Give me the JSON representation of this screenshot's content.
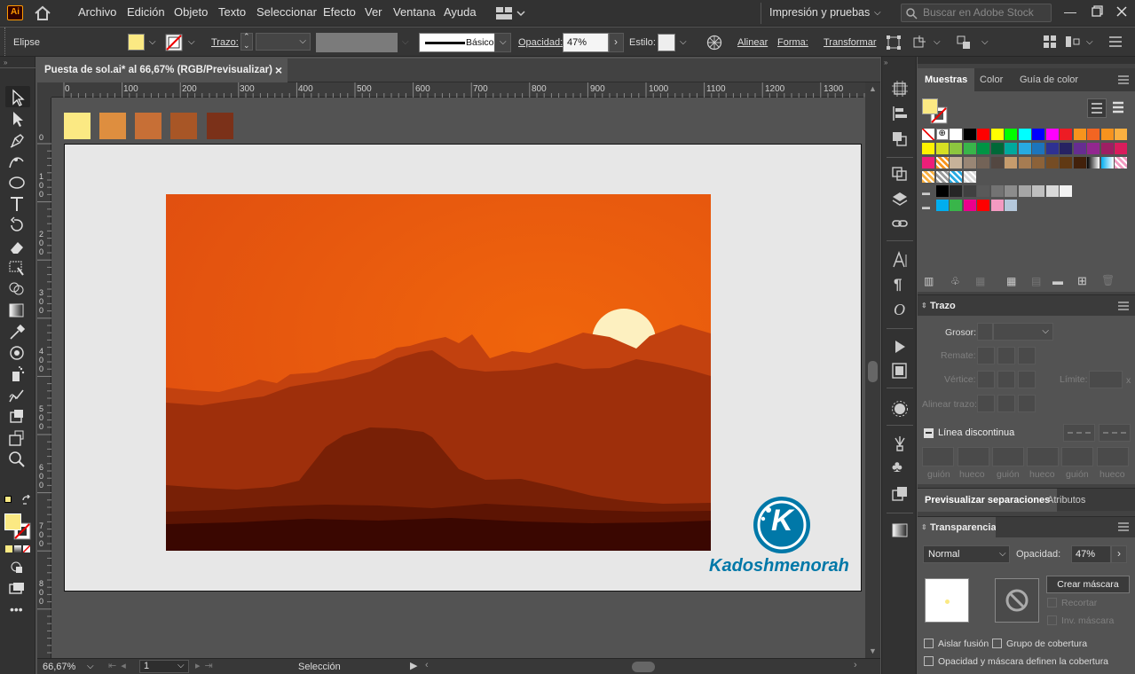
{
  "menubar": {
    "app_logo": "Ai",
    "items": [
      "Archivo",
      "Edición",
      "Objeto",
      "Texto",
      "Seleccionar",
      "Efecto",
      "Ver",
      "Ventana",
      "Ayuda"
    ],
    "workspace": "Impresión y pruebas",
    "search_placeholder": "Buscar en Adobe Stock"
  },
  "control_bar": {
    "object_type": "Elipse",
    "stroke_label": "Trazo:",
    "brush_label": "Básico",
    "opacity_label": "Opacidad:",
    "opacity_value": "47%",
    "style_label": "Estilo:",
    "align_label": "Alinear",
    "shape_label": "Forma:",
    "transform_label": "Transformar"
  },
  "document_tab": {
    "title": "Puesta de sol.ai* al 66,67% (RGB/Previsualizar)",
    "close": "×"
  },
  "ruler_h": [
    "0",
    "100",
    "200",
    "300",
    "400",
    "500",
    "600",
    "700",
    "800",
    "900",
    "1000",
    "1100",
    "1200",
    "1300"
  ],
  "ruler_v": [
    "0",
    "1\n0\n0",
    "2\n0\n0",
    "3\n0\n0",
    "4\n0\n0",
    "5\n0\n0",
    "6\n0\n0",
    "7\n0\n0",
    "8\n0\n0"
  ],
  "palette_swatches": [
    "#fbe983",
    "#de8e3f",
    "#c76f36",
    "#a85626",
    "#7b3119"
  ],
  "artwork": {
    "sky_top": "#df4d10",
    "sky_glow": "#f0650c",
    "sun_color": "#fdf0c0",
    "mountain_colors": [
      "#c2410f",
      "#9e2f0b",
      "#782006",
      "#5c1403",
      "#3a0701"
    ]
  },
  "watermark": {
    "letter": "K",
    "text": "Kadoshmenorah",
    "color": "#0078a8"
  },
  "status_bar": {
    "zoom": "66,67%",
    "artboard": "1",
    "tool": "Selección"
  },
  "panels": {
    "swatch_tabs": [
      "Muestras",
      "Color",
      "Guía de color"
    ],
    "stroke": {
      "title": "Trazo",
      "weight_label": "Grosor:",
      "cap_label": "Remate:",
      "corner_label": "Vértice:",
      "limit_label": "Límite:",
      "limit_unit": "x",
      "align_label": "Alinear trazo:",
      "dashed_label": "Línea discontinua",
      "dash_labels": [
        "guión",
        "hueco",
        "guión",
        "hueco",
        "guión",
        "hueco"
      ]
    },
    "bottom_tabs": [
      "Previsualizar separaciones",
      "Atributos"
    ],
    "transparency": {
      "title": "Transparencia",
      "blend_mode": "Normal",
      "opacity_label": "Opacidad:",
      "opacity_value": "47%",
      "make_mask": "Crear máscara",
      "clip": "Recortar",
      "invert_mask": "Inv. máscara",
      "isolate": "Aislar fusión",
      "knockout": "Grupo de cobertura",
      "opacity_mask": "Opacidad y máscara definen la cobertura"
    }
  },
  "colors": {
    "fill": "#fbe983",
    "accent_bg": "#323232"
  }
}
